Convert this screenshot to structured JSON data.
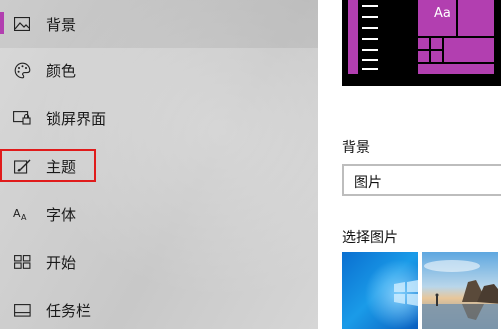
{
  "sidebar": {
    "items": [
      {
        "label": "背景",
        "icon": "picture-icon",
        "selected": true
      },
      {
        "label": "颜色",
        "icon": "palette-icon"
      },
      {
        "label": "锁屏界面",
        "icon": "lock-screen-icon"
      },
      {
        "label": "主题",
        "icon": "theme-icon",
        "highlighted": true
      },
      {
        "label": "字体",
        "icon": "font-icon"
      },
      {
        "label": "开始",
        "icon": "start-icon"
      },
      {
        "label": "任务栏",
        "icon": "taskbar-icon"
      }
    ]
  },
  "main": {
    "preview": {
      "sample_text": "Aa"
    },
    "background_heading": "背景",
    "background_select": {
      "value": "图片"
    },
    "choose_picture_heading": "选择图片"
  },
  "colors": {
    "accent": "#b23fb0",
    "highlight": "#e01b1b"
  }
}
